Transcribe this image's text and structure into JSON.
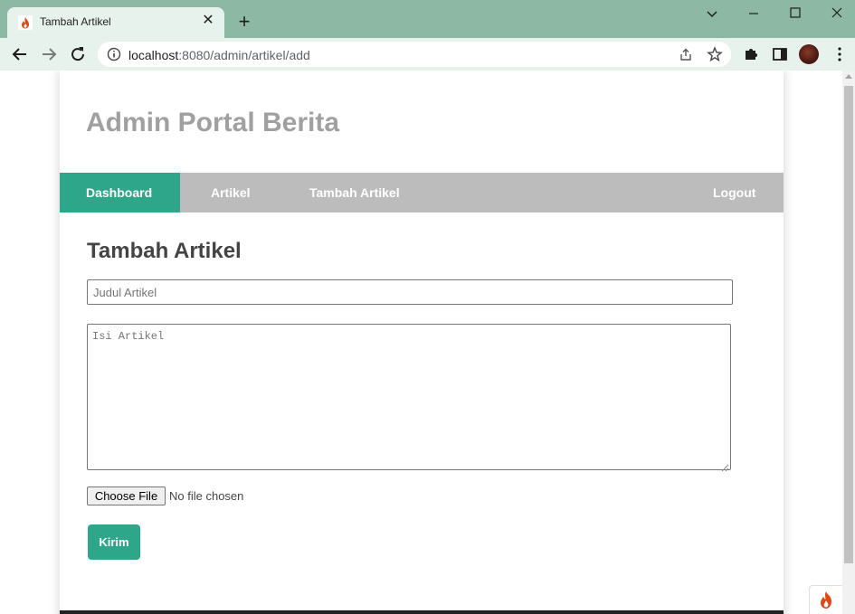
{
  "browser": {
    "tab_title": "Tambah Artikel",
    "tab_close": "✕",
    "new_tab": "+",
    "url_host": "localhost",
    "url_rest": ":8080/admin/artikel/add"
  },
  "site": {
    "title": "Admin Portal Berita"
  },
  "nav": {
    "dashboard": "Dashboard",
    "artikel": "Artikel",
    "tambah_artikel": "Tambah Artikel",
    "logout": "Logout"
  },
  "form": {
    "heading": "Tambah Artikel",
    "judul_placeholder": "Judul Artikel",
    "isi_placeholder": "Isi Artikel",
    "file_button": "Choose File",
    "file_status": "No file chosen",
    "submit_label": "Kirim"
  },
  "colors": {
    "accent": "#2ea68a",
    "nav_bg": "#bcbcbc",
    "title": "#a0a0a0",
    "chrome_frame": "#8db8a4"
  }
}
